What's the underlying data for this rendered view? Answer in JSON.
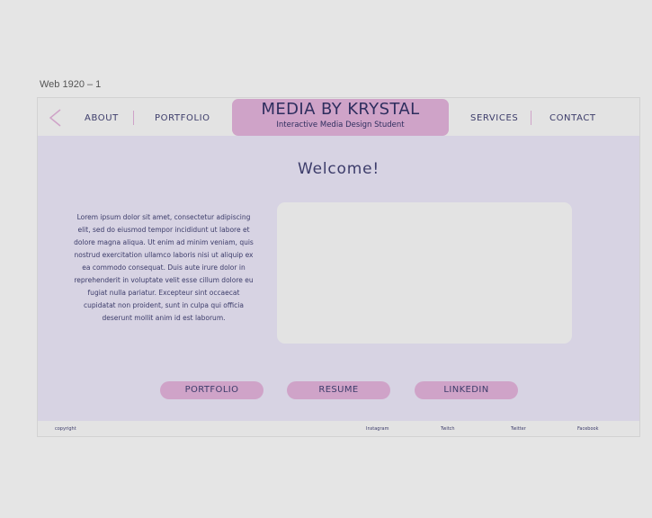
{
  "frame": {
    "label": "Web 1920 – 1"
  },
  "nav": {
    "back_icon": "chevron-left-icon",
    "about": "ABOUT",
    "portfolio": "PORTFOLIO",
    "services": "SERVICES",
    "contact": "CONTACT"
  },
  "brand": {
    "title": "MEDIA BY KRYSTAL",
    "subtitle": "Interactive Media Design Student"
  },
  "main": {
    "welcome": "Welcome!",
    "intro": "Lorem ipsum dolor sit amet, consectetur adipiscing elit, sed do eiusmod tempor incididunt ut labore et dolore magna aliqua. Ut enim ad minim veniam, quis nostrud exercitation ullamco laboris nisi ut aliquip ex ea commodo consequat. Duis aute irure dolor in reprehenderit in voluptate velit esse cillum dolore eu fugiat nulla pariatur. Excepteur sint occaecat cupidatat non proident, sunt in culpa qui officia deserunt mollit anim id est laborum.",
    "buttons": {
      "portfolio": "PORTFOLIO",
      "resume": "RESUME",
      "linkedin": "LINKEDIN"
    }
  },
  "footer": {
    "copyright": "copyright",
    "instagram": "Instagram",
    "twitch": "Twitch",
    "twitter": "Twitter",
    "facebook": "Facebook"
  },
  "colors": {
    "accent_pink": "#cfa3c8",
    "main_lavender": "#d7d3e3",
    "text_navy": "#3c3c6a",
    "chrome_gray": "#e3e3e3"
  }
}
